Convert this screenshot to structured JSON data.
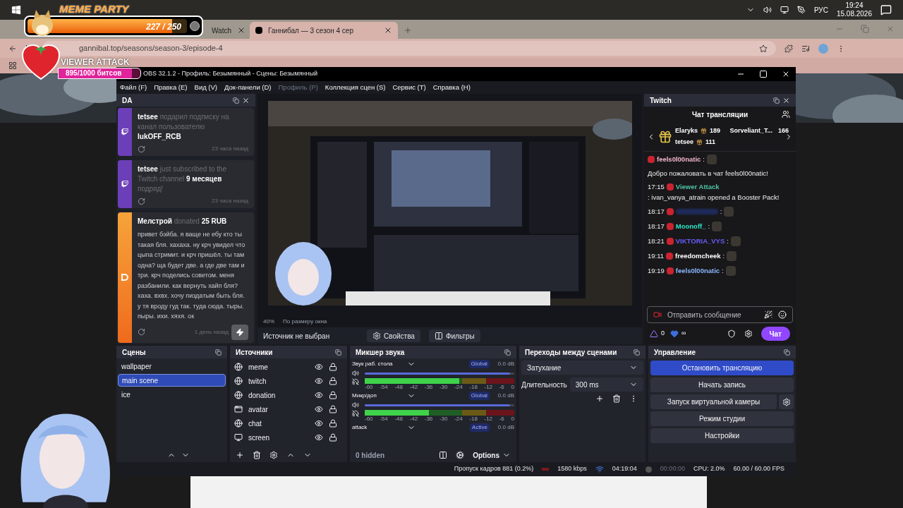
{
  "taskbar": {
    "language": "РУС",
    "time": "19:24",
    "date": "15.08.2026"
  },
  "browser": {
    "tabs": [
      {
        "title": "Watch",
        "selected": false
      },
      {
        "title": "Ганнибал — 3 сезон 4 сер",
        "selected": true
      }
    ],
    "url": "gannibal.top/seasons/season-3/episode-4"
  },
  "overlays": {
    "meme_party": {
      "title": "MEME PARTY",
      "count": "227 / 250",
      "level": 0.908
    },
    "viewer_attack": {
      "title": "VIEWER ATTACK",
      "count": "895/1000 битсов",
      "level": 0.895
    }
  },
  "obs": {
    "title": "OBS 32.1.2 - Профиль: Безымянный - Сцены: Безымянный",
    "menu": [
      {
        "label": "Файл (F)",
        "disabled": false
      },
      {
        "label": "Правка (E)",
        "disabled": false
      },
      {
        "label": "Вид (V)",
        "disabled": false
      },
      {
        "label": "Док-панели (D)",
        "disabled": false
      },
      {
        "label": "Профиль (P)",
        "disabled": true
      },
      {
        "label": "Коллекция сцен (S)",
        "disabled": false
      },
      {
        "label": "Сервис (T)",
        "disabled": false
      },
      {
        "label": "Справка (H)",
        "disabled": false
      }
    ],
    "alerts_dock": {
      "title": "DA",
      "alerts": [
        {
          "kind": "twitch",
          "text": "**tetsee** подарил подписку на канал пользователю **lukOFF_RCB**",
          "time": "23 часа назад"
        },
        {
          "kind": "twitch",
          "text": "**tetsee** just subscribed to the Twitch channel **9 месяцев** подряд!",
          "time": "23 часа назад"
        },
        {
          "kind": "donation",
          "text": "**Мелстрой** donated **25 RUB**",
          "message": "привет бэйба. я ваще не ебу кто ты такая бля. хахаха. ну крч увидел что цыпа стримит. и крч пришёл. ты там одна? ща будет две. а где две там и три. крч поделись советом. меня разбанили. как вернуть хайп бля? хаха. вхвх. хочу пиздатым быть бля. у тя вроду гуд так. туда сюда. тыры. пыры. ихи. хяхя. ок",
          "time": "1 день назад"
        }
      ]
    },
    "preview": {
      "zoom": "40%",
      "fit": "По размеру окна"
    },
    "source_bar": {
      "status": "Источник не выбран",
      "properties": "Свойства",
      "filters": "Фильтры"
    },
    "chat_dock": {
      "title": "Twitch",
      "heading": "Чат трансляции",
      "leaders": [
        {
          "name": "Elaryks",
          "count": "189"
        },
        {
          "name": "Sorveliant_T...",
          "count": "166"
        },
        {
          "name": "tetsee",
          "count": "111"
        }
      ],
      "messages": [
        {
          "kind": "user",
          "user": "feels0l00natic",
          "sep": ":",
          "color": "#f4b6c8"
        },
        {
          "kind": "system",
          "text": "Добро пожаловать в чат feels0l00natic!"
        },
        {
          "kind": "reward",
          "time": "17:15",
          "user": "Viewer Attack",
          "color": "#4fc3a1",
          "text": ": ivan_vanya_atrain opened a Booster Pack!"
        },
        {
          "kind": "blurred",
          "time": "18:17",
          "sep": ":"
        },
        {
          "kind": "user",
          "time": "18:17",
          "user": "Moonoff_",
          "sep": ":",
          "color": "#2ee6c7"
        },
        {
          "kind": "user",
          "time": "18:21",
          "user": "VIKTORIA_VYS",
          "sep": ":",
          "color": "#6a5cff"
        },
        {
          "kind": "user",
          "time": "19:11",
          "user": "freedomcheek",
          "sep": ":",
          "color": "#ffffff"
        },
        {
          "kind": "user",
          "time": "19:19",
          "user": "feels0l00natic",
          "sep": ":",
          "color": "#8ab8ff"
        }
      ],
      "placeholder": "Отправить сообщение",
      "points": "0",
      "hearts": "∞",
      "send": "Чат"
    },
    "scenes": {
      "title": "Сцены",
      "items": [
        {
          "name": "wallpaper",
          "selected": false
        },
        {
          "name": "main scene",
          "selected": true
        },
        {
          "name": "ice",
          "selected": false
        }
      ]
    },
    "sources": {
      "title": "Источники",
      "items": [
        {
          "name": "meme",
          "kind": "browser",
          "visible": true,
          "locked": true
        },
        {
          "name": "twitch",
          "kind": "browser",
          "visible": true,
          "locked": true
        },
        {
          "name": "donation",
          "kind": "browser",
          "visible": true,
          "locked": true
        },
        {
          "name": "avatar",
          "kind": "window",
          "visible": true,
          "locked": true
        },
        {
          "name": "chat",
          "kind": "browser",
          "visible": true,
          "locked": true
        },
        {
          "name": "screen",
          "kind": "display",
          "visible": true,
          "locked": true
        }
      ]
    },
    "mixer": {
      "title": "Микшер звука",
      "channels": [
        {
          "name": "Звук раб. стола",
          "badge": "Global",
          "reading": "0.0 dB",
          "volume": {
            "level": 0.97
          },
          "meter": {
            "level": 0.63
          },
          "ticks": [
            "-60",
            "-54",
            "-48",
            "-42",
            "-36",
            "-30",
            "-24",
            "-18",
            "-12",
            "-6",
            "0"
          ]
        },
        {
          "name": "Микр/доп",
          "badge": "Global",
          "reading": "0.0 dB",
          "volume": {
            "level": 0.97
          },
          "meter": {
            "level": 0.43
          },
          "ticks": [
            "-60",
            "-54",
            "-48",
            "-42",
            "-36",
            "-30",
            "-24",
            "-18",
            "-12",
            "-6",
            "0"
          ]
        },
        {
          "name": "attack",
          "badge": "Active",
          "reading": "0.0 dB"
        }
      ],
      "hidden": "0 hidden",
      "options": "Options"
    },
    "transitions": {
      "title": "Переходы между сценами",
      "transition": "Затухание",
      "duration_label": "Длительность",
      "duration": "300 ms"
    },
    "controls": {
      "title": "Управление",
      "buttons": [
        {
          "label": "Остановить трансляцию",
          "active": true,
          "settings": false
        },
        {
          "label": "Начать запись",
          "active": false,
          "settings": false
        },
        {
          "label": "Запуск виртуальной камеры",
          "active": false,
          "settings": true
        },
        {
          "label": "Режим студии",
          "active": false,
          "settings": false
        },
        {
          "label": "Настройки",
          "active": false,
          "settings": false
        }
      ]
    },
    "status_bar": {
      "dropped": "Пропуск кадров 881 (0.2%)",
      "bitrate": "1580 kbps",
      "stream_time": "04:19:04",
      "record_time": "00:00:00",
      "cpu": "CPU: 2.0%",
      "fps": "60.00 / 60.00 FPS"
    }
  }
}
